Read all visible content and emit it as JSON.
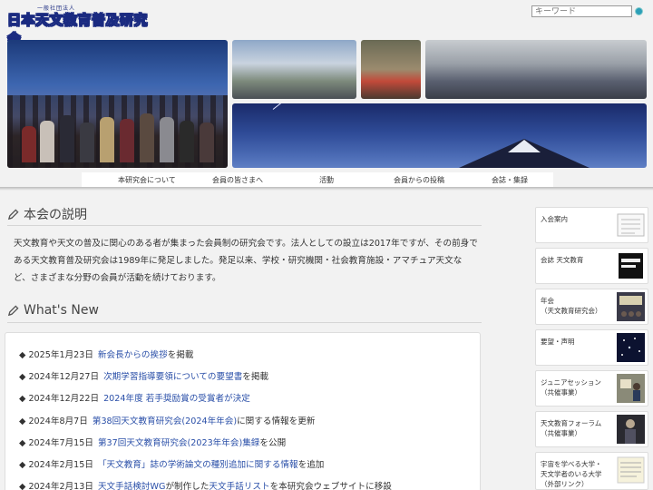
{
  "header": {
    "logo_small": "一般社団法人",
    "logo_main": "日本天文教育普及研究会",
    "search_placeholder": "キーワード"
  },
  "nav": {
    "items": [
      {
        "label": "本研究会について"
      },
      {
        "label": "会員の皆さまへ"
      },
      {
        "label": "活動"
      },
      {
        "label": "会員からの投稿"
      },
      {
        "label": "会誌・集録"
      }
    ]
  },
  "about": {
    "title": "本会の説明",
    "text": "天文教育や天文の普及に関心のある者が集まった会員制の研究会です。法人としての設立は2017年ですが、その前身である天文教育普及研究会は1989年に発足しました。発足以来、学校・研究機関・社会教育施設・アマチュア天文など、さまざまな分野の会員が活動を続けております。"
  },
  "whats_new": {
    "title": "What's New",
    "items": [
      {
        "date": "2025年1月23日",
        "link": "新会長からの挨拶",
        "text": "を掲載"
      },
      {
        "date": "2024年12月27日",
        "link": "次期学習指導要領についての要望書",
        "text": "を掲載"
      },
      {
        "date": "2024年12月22日",
        "link": "2024年度 若手奨励賞の受賞者が決定",
        "text": ""
      },
      {
        "date": "2024年8月7日",
        "link": "第38回天文教育研究会(2024年年会)",
        "text": "に関する情報を更新"
      },
      {
        "date": "2024年7月15日",
        "link": "第37回天文教育研究会(2023年年会)集録",
        "text": "を公開"
      },
      {
        "date": "2024年2月15日",
        "link": "「天文教育」誌の学術論文の種別追加に関する情報",
        "text": "を追加"
      },
      {
        "date": "2024年2月13日",
        "link": "天文手話検討WG",
        "text": "が制作した",
        "link2": "天文手話リスト",
        "text2": "を本研究会ウェブサイトに移設"
      }
    ]
  },
  "sidebar": {
    "items": [
      {
        "label": "入会案内",
        "icon": "application-form-icon"
      },
      {
        "label": "会誌 天文教育",
        "icon": "journal-cover-icon"
      },
      {
        "label": "年会\n（天文教育研究会）",
        "icon": "meeting-photo-icon"
      },
      {
        "label": "要望・声明",
        "icon": "night-sky-icon"
      },
      {
        "label": "ジュニアセッション\n（共催事業）",
        "icon": "junior-session-icon"
      },
      {
        "label": "天文教育フォーラム\n（共催事業）",
        "icon": "forum-photo-icon"
      },
      {
        "label": "宇宙を学べる大学・\n天文学者のいる大学\n（外部リンク）",
        "icon": "university-list-icon"
      }
    ]
  },
  "colors": {
    "link": "#2a4fa8",
    "logo_outline": "#1a2a80",
    "background": "#f2f2f2"
  }
}
